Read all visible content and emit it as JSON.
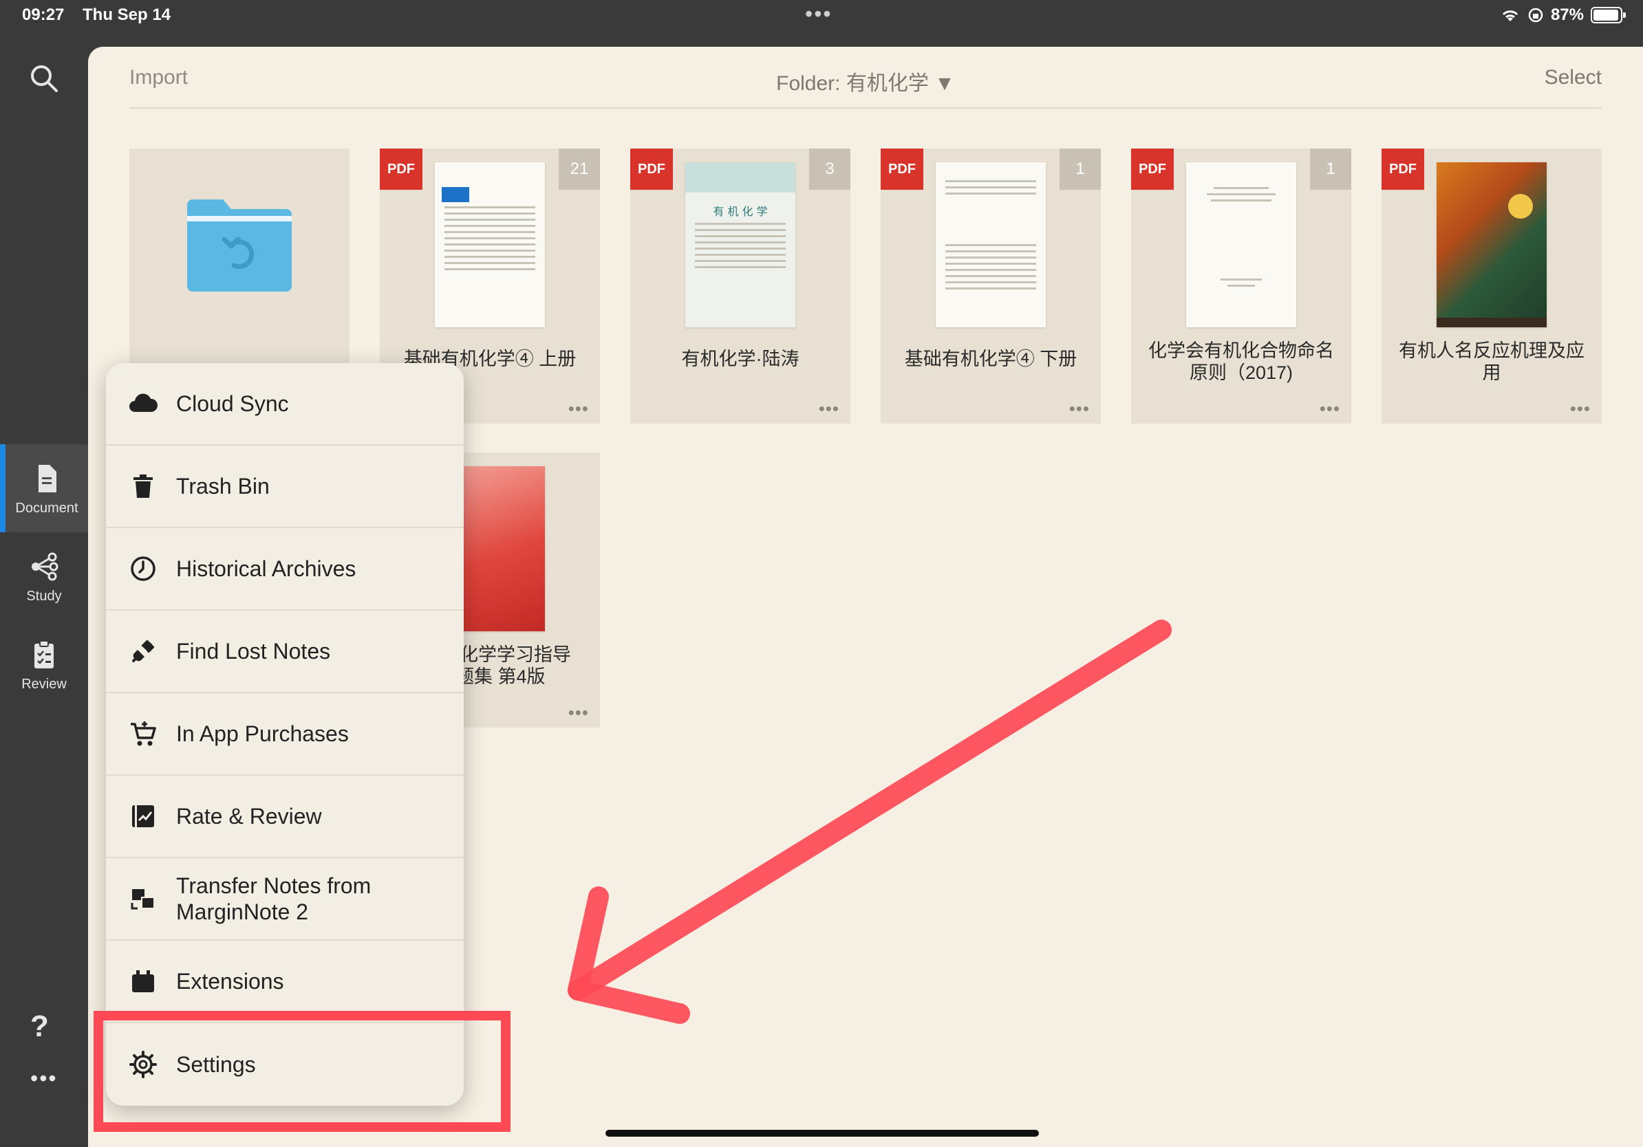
{
  "status": {
    "time": "09:27",
    "date": "Thu Sep 14",
    "battery": "87%"
  },
  "rail": {
    "items": [
      {
        "label": "Document",
        "active": true
      },
      {
        "label": "Study"
      },
      {
        "label": "Review"
      }
    ],
    "help_label": "?"
  },
  "toolbar": {
    "import": "Import",
    "folder": "Folder: 有机化学 ▼",
    "select": "Select"
  },
  "documents": [
    {
      "badge": "PDF",
      "count": "21",
      "title": "基础有机化学④ 上册"
    },
    {
      "badge": "PDF",
      "count": "3",
      "title": "有机化学·陆涛"
    },
    {
      "badge": "PDF",
      "count": "1",
      "title": "基础有机化学④ 下册"
    },
    {
      "badge": "PDF",
      "count": "1",
      "title": "化学会有机化合物命名原则（2017)"
    },
    {
      "badge": "PDF",
      "count": "",
      "title": "有机人名反应机理及应用"
    },
    {
      "badge": "",
      "count": "",
      "title": "l化学学习指导题集 第4版"
    }
  ],
  "menu": {
    "items": [
      {
        "label": "Cloud Sync",
        "icon": "cloud-icon"
      },
      {
        "label": "Trash Bin",
        "icon": "trash-icon"
      },
      {
        "label": "Historical Archives",
        "icon": "clock-icon"
      },
      {
        "label": "Find Lost Notes",
        "icon": "plug-icon"
      },
      {
        "label": "In App Purchases",
        "icon": "cart-icon"
      },
      {
        "label": "Rate & Review",
        "icon": "chart-icon"
      },
      {
        "label": "Transfer Notes from MarginNote 2",
        "icon": "transfer-icon"
      },
      {
        "label": "Extensions",
        "icon": "extension-icon"
      },
      {
        "label": "Settings",
        "icon": "gear-icon"
      }
    ]
  },
  "colors": {
    "accent": "#1e88e5",
    "pdf_badge": "#d9342b",
    "highlight": "#ff4a56",
    "panel_bg": "#f6efe3"
  }
}
